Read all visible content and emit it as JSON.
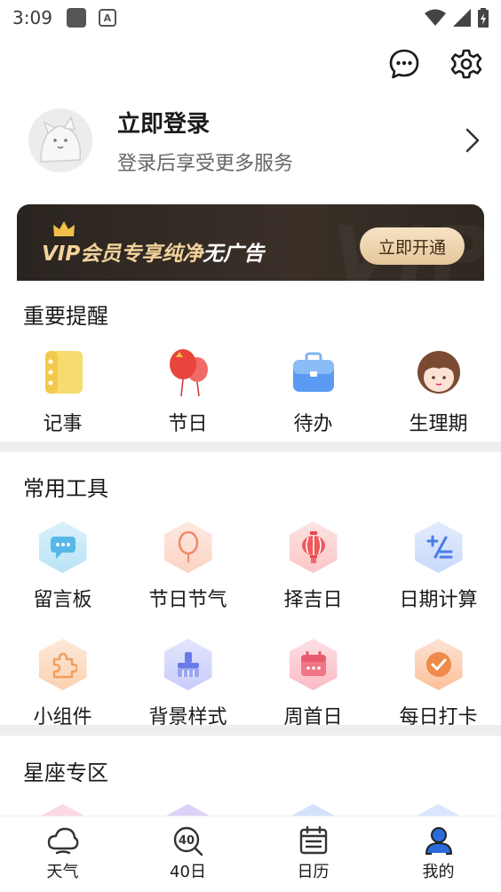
{
  "status_bar": {
    "time": "3:09",
    "a_icon": "A"
  },
  "profile": {
    "title": "立即登录",
    "subtitle": "登录后享受更多服务"
  },
  "vip": {
    "text_gold": "VIP会员专享纯净",
    "text_white": "无广告",
    "button": "立即开通",
    "bg_text": "VIP"
  },
  "reminders": {
    "title": "重要提醒",
    "items": [
      {
        "label": "记事",
        "icon": "notebook-icon"
      },
      {
        "label": "节日",
        "icon": "balloon-icon"
      },
      {
        "label": "待办",
        "icon": "briefcase-icon"
      },
      {
        "label": "生理期",
        "icon": "girl-face-icon"
      }
    ]
  },
  "tools": {
    "title": "常用工具",
    "items": [
      {
        "label": "留言板",
        "icon": "message-board-icon"
      },
      {
        "label": "节日节气",
        "icon": "balloon-icon"
      },
      {
        "label": "择吉日",
        "icon": "lantern-icon"
      },
      {
        "label": "日期计算",
        "icon": "calculator-icon"
      },
      {
        "label": "小组件",
        "icon": "puzzle-icon"
      },
      {
        "label": "背景样式",
        "icon": "brush-icon"
      },
      {
        "label": "周首日",
        "icon": "calendar-icon"
      },
      {
        "label": "每日打卡",
        "icon": "check-icon"
      }
    ]
  },
  "zodiac": {
    "title": "星座专区"
  },
  "bottom_nav": [
    {
      "label": "天气",
      "icon": "weather-icon"
    },
    {
      "label": "40日",
      "icon": "forty-day-icon",
      "glyph": "40"
    },
    {
      "label": "日历",
      "icon": "calendar-icon"
    },
    {
      "label": "我的",
      "icon": "user-icon",
      "active": true
    }
  ],
  "colors": {
    "accent": "#2a6bd8",
    "vip_gold": "#f3d39b",
    "vip_bg": "#2a2420"
  }
}
